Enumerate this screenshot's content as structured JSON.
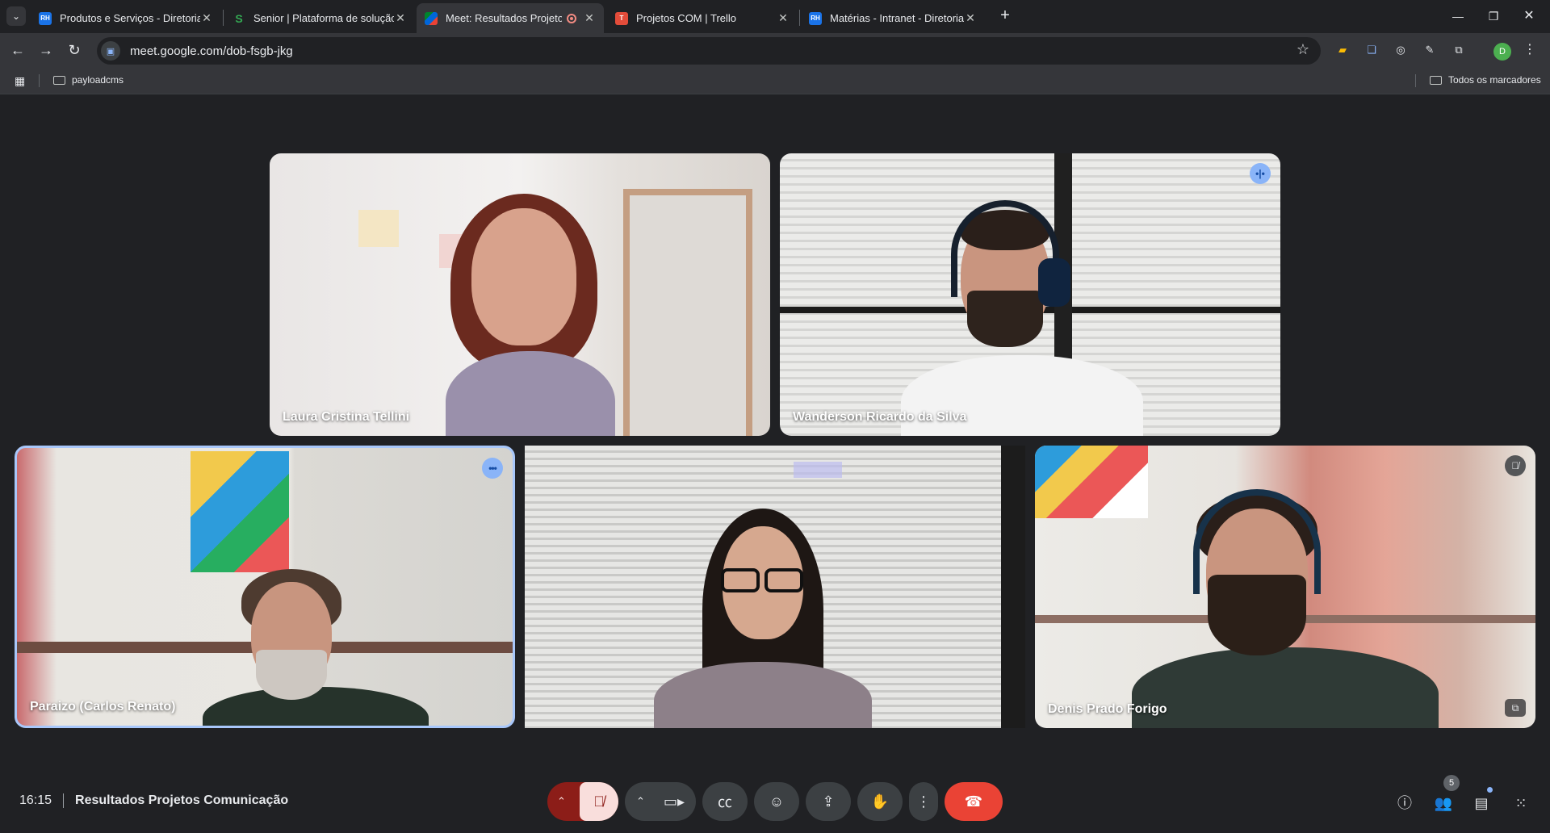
{
  "browser": {
    "tabs": [
      {
        "title": "Produtos e Serviços - Diretoria",
        "favicon": "RH"
      },
      {
        "title": "Senior | Plataforma de solução",
        "favicon": "S"
      },
      {
        "title": "Meet: Resultados Projetos C",
        "favicon": "Meet"
      },
      {
        "title": "Projetos COM | Trello",
        "favicon": "T"
      },
      {
        "title": "Matérias - Intranet - Diretoria C",
        "favicon": "RH"
      }
    ],
    "url": "meet.google.com/dob-fsgb-jkg",
    "profile_initial": "D",
    "bookmarks": [
      {
        "label": "payloadcms"
      }
    ],
    "all_bookmarks_label": "Todos os marcadores"
  },
  "participants": [
    {
      "name": "Laura Cristina Tellini"
    },
    {
      "name": "Wanderson Ricardo da Silva"
    },
    {
      "name": "Paraizo (Carlos Renato)"
    },
    {
      "name": ""
    },
    {
      "name": "Denis Prado Forigo"
    }
  ],
  "meeting": {
    "time": "16:15",
    "title": "Resultados Projetos Comunicação",
    "participant_count": "5"
  },
  "colors": {
    "accent": "#8ab4f8",
    "end_call": "#ea4335",
    "mic_muted_bg": "#8c1d18",
    "control_bg": "#3c4043"
  }
}
